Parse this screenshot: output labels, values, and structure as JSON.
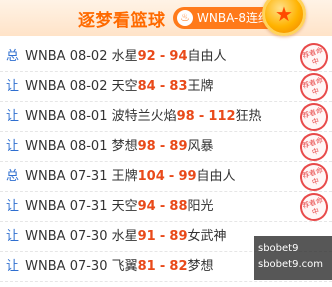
{
  "header": {
    "title": "逐梦看篮球",
    "streak_label": "WNBA-8连红",
    "streak_icon": "flame-icon"
  },
  "rows": [
    {
      "tag": "总",
      "league": "WNBA",
      "date": "08-02",
      "home": "水星",
      "home_score": "92",
      "away_score": "94",
      "away": "自由人",
      "stamp": "荐者命中"
    },
    {
      "tag": "让",
      "league": "WNBA",
      "date": "08-02",
      "home": "天空",
      "home_score": "84",
      "away_score": "83",
      "away": "王牌",
      "stamp": "荐者命中"
    },
    {
      "tag": "让",
      "league": "WNBA",
      "date": "08-01",
      "home": "波特兰火焰",
      "home_score": "98",
      "away_score": "112",
      "away": "狂热",
      "stamp": "荐者命中"
    },
    {
      "tag": "让",
      "league": "WNBA",
      "date": "08-01",
      "home": "梦想",
      "home_score": "98",
      "away_score": "89",
      "away": "风暴",
      "stamp": "荐者命中"
    },
    {
      "tag": "总",
      "league": "WNBA",
      "date": "07-31",
      "home": "王牌",
      "home_score": "104",
      "away_score": "99",
      "away": "自由人",
      "stamp": "荐者命中"
    },
    {
      "tag": "让",
      "league": "WNBA",
      "date": "07-31",
      "home": "天空",
      "home_score": "94",
      "away_score": "88",
      "away": "阳光",
      "stamp": "荐者命中"
    },
    {
      "tag": "让",
      "league": "WNBA",
      "date": "07-30",
      "home": "水星",
      "home_score": "91",
      "away_score": "89",
      "away": "女武神",
      "stamp": "荐者命中"
    },
    {
      "tag": "让",
      "league": "WNBA",
      "date": "07-30",
      "home": "飞翼",
      "home_score": "81",
      "away_score": "82",
      "away": "梦想",
      "stamp": "荐者命中"
    }
  ],
  "watermark": {
    "line1": "sbo​bet9",
    "line2": "sbobet9.com"
  },
  "colors": {
    "accent": "#ff6a00",
    "score": "#e94a1a",
    "tag": "#2f6fd0",
    "stamp": "#e84a4a"
  }
}
